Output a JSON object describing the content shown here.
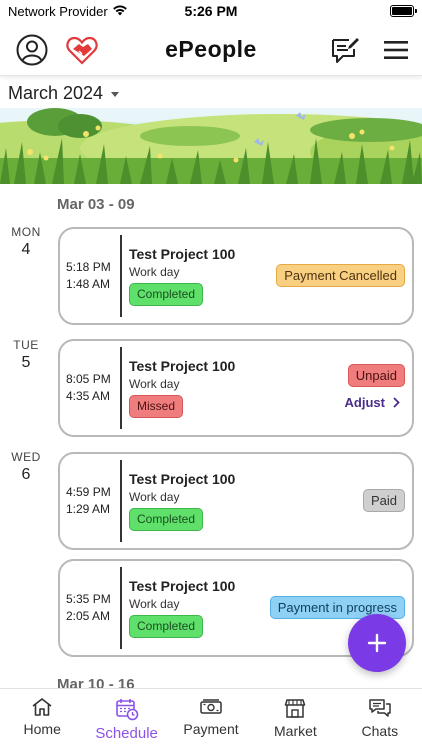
{
  "status_bar": {
    "carrier": "Network Provider",
    "time": "5:26 PM"
  },
  "header": {
    "title": "ePeople"
  },
  "month_selector": {
    "label": "March 2024"
  },
  "weeks": [
    {
      "label": "Mar 03 - 09"
    },
    {
      "label": "Mar 10 - 16"
    }
  ],
  "days": [
    {
      "name": "MON",
      "num": "4"
    },
    {
      "name": "TUE",
      "num": "5"
    },
    {
      "name": "WED",
      "num": "6"
    }
  ],
  "shifts": [
    {
      "start": "5:18 PM",
      "end": "1:48 AM",
      "title": "Test Project 100",
      "subtitle": "Work day",
      "status": "Completed",
      "payment": "Payment Cancelled"
    },
    {
      "start": "8:05 PM",
      "end": "4:35 AM",
      "title": "Test Project 100",
      "subtitle": "Work day",
      "status": "Missed",
      "payment": "Unpaid",
      "action": "Adjust"
    },
    {
      "start": "4:59 PM",
      "end": "1:29 AM",
      "title": "Test Project 100",
      "subtitle": "Work day",
      "status": "Completed",
      "payment": "Paid"
    },
    {
      "start": "5:35 PM",
      "end": "2:05 AM",
      "title": "Test Project 100",
      "subtitle": "Work day",
      "status": "Completed",
      "payment": "Payment in progress"
    }
  ],
  "fab": {
    "icon": "plus-icon"
  },
  "bottom_nav": {
    "items": [
      {
        "label": "Home",
        "icon": "home-icon"
      },
      {
        "label": "Schedule",
        "icon": "calendar-clock-icon",
        "active": true
      },
      {
        "label": "Payment",
        "icon": "cash-icon"
      },
      {
        "label": "Market",
        "icon": "storefront-icon"
      },
      {
        "label": "Chats",
        "icon": "chat-bubbles-icon"
      }
    ]
  },
  "colors": {
    "accent": "#8b52e8",
    "fab": "#7a3ae6",
    "completed": "#5fe06b",
    "missed": "#f07d7d",
    "cancelled": "#f9cf82",
    "paid": "#cfcfcf",
    "in_progress": "#8fd0f5",
    "logo_red": "#e23a3a"
  }
}
